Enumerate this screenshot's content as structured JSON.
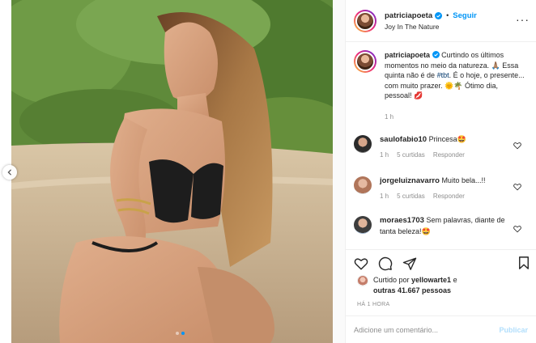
{
  "post": {
    "username": "patriciapoeta",
    "follow_label": "Seguir",
    "separator": "•",
    "location": "Joy In The Nature",
    "caption_prefix": "Curtindo os últimos momentos no meio da natureza. 🙏🏽 Essa quinta não é de ",
    "hashtag": "#tbt",
    "caption_suffix": ". É o hoje, o presente... com muito prazer. 🌞🌴 Ótimo dia, pessoal! 💋",
    "caption_time": "1 h"
  },
  "comments": [
    {
      "username": "saulofabio10",
      "text": "Princesa🤩",
      "time": "1 h",
      "likes": "5 curtidas",
      "reply": "Responder"
    },
    {
      "username": "jorgeluiznavarro",
      "text": "Muito bela...!!",
      "time": "1 h",
      "likes": "5 curtidas",
      "reply": "Responder"
    },
    {
      "username": "moraes1703",
      "text": "Sem palavras, diante de tanta beleza!🤩",
      "time": "",
      "likes": "",
      "reply": ""
    }
  ],
  "likes": {
    "prefix": "Curtido por ",
    "user": "yellowarte1",
    "middle": " e",
    "others": "outras 41.667 pessoas"
  },
  "timestamp": "HÁ 1 HORA",
  "add_comment": {
    "placeholder": "Adicione um comentário...",
    "publish_label": "Publicar"
  },
  "carousel": {
    "slide_count": 2,
    "active_index": 1
  },
  "colors": {
    "accent": "#0095f6",
    "hashtag": "#00376b",
    "muted": "#8e8e8e",
    "publish_disabled": "#b2dffc"
  }
}
